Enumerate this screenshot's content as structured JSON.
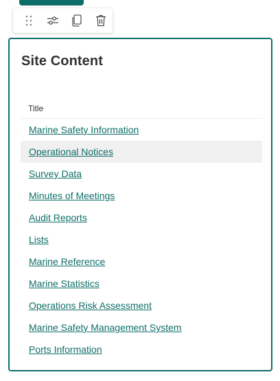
{
  "toolbar": {
    "icons": [
      "drag-handle-icon",
      "settings-sliders-icon",
      "copy-icon",
      "delete-icon"
    ]
  },
  "webpart": {
    "title": "Site Content",
    "column_header": "Title",
    "items": [
      {
        "label": "Marine Safety Information"
      },
      {
        "label": "Operational Notices"
      },
      {
        "label": "Survey Data"
      },
      {
        "label": "Minutes of Meetings"
      },
      {
        "label": "Audit Reports"
      },
      {
        "label": "Lists"
      },
      {
        "label": "Marine Reference"
      },
      {
        "label": "Marine Statistics"
      },
      {
        "label": "Operations Risk Assessment"
      },
      {
        "label": "Marine Safety Management System"
      },
      {
        "label": "Ports Information"
      }
    ]
  },
  "colors": {
    "accent": "#0d6e68",
    "link": "#0d6e68",
    "hover_row": "#f0f0f0",
    "text": "#323130"
  }
}
